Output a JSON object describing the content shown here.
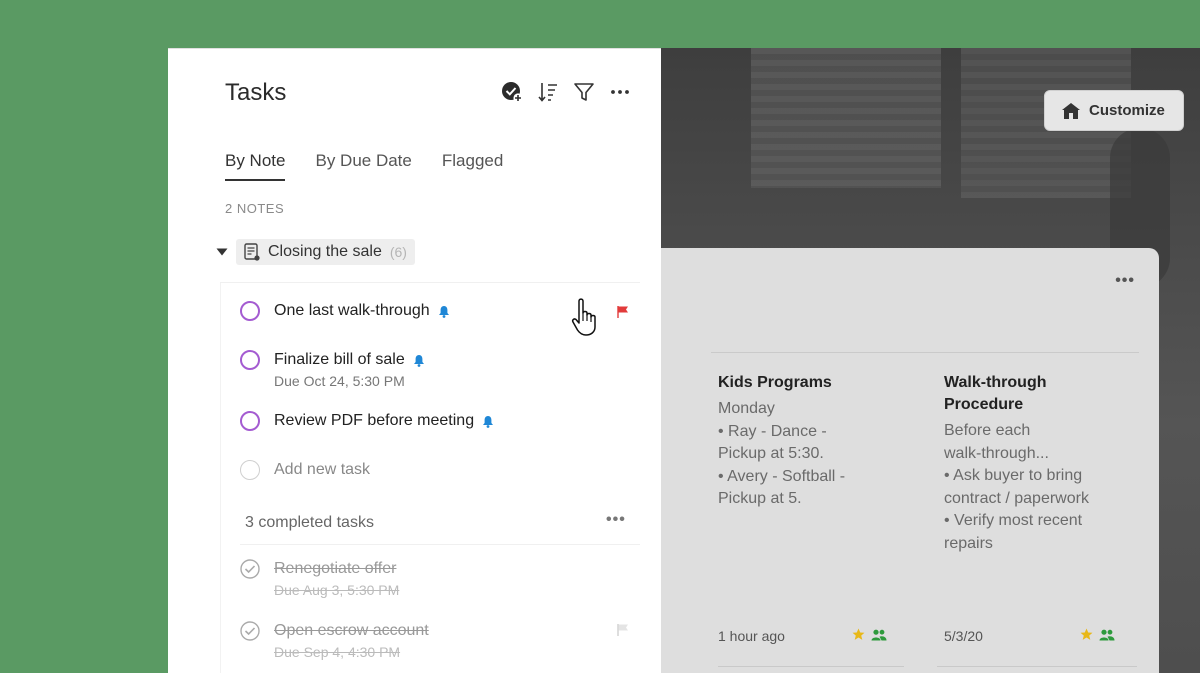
{
  "right": {
    "customize_label": "Customize",
    "notes": [
      {
        "title": "Kids Programs",
        "body": "Monday\n• Ray - Dance -\nPickup at 5:30.\n• Avery - Softball -\nPickup at 5.",
        "date": "1 hour ago"
      },
      {
        "title": "Walk-through\nProcedure",
        "body": "Before each\nwalk-through...\n• Ask buyer to bring\ncontract / paperwork\n• Verify most recent\nrepairs",
        "date": "5/3/20"
      }
    ]
  },
  "tasks": {
    "title": "Tasks",
    "tabs": [
      {
        "label": "By Note",
        "active": true
      },
      {
        "label": "By Due Date",
        "active": false
      },
      {
        "label": "Flagged",
        "active": false
      }
    ],
    "notes_count": "2 NOTES",
    "group": {
      "name": "Closing the sale",
      "count": "(6)"
    },
    "items": [
      {
        "title": "One last walk-through",
        "due": "",
        "reminder": true,
        "flagged": true
      },
      {
        "title": "Finalize bill of sale",
        "due": "Due Oct 24, 5:30 PM",
        "reminder": true,
        "flagged": false
      },
      {
        "title": "Review PDF before meeting",
        "due": "",
        "reminder": true,
        "flagged": false
      }
    ],
    "add_task_label": "Add new task",
    "completed_label": "3 completed tasks",
    "completed": [
      {
        "title": "Renegotiate offer",
        "due": "Due Aug 3, 5:30 PM",
        "flagged": false
      },
      {
        "title": "Open escrow account",
        "due": "Due Sep 4, 4:30 PM",
        "flagged": true
      }
    ]
  },
  "colors": {
    "background": "#5a9a63",
    "task_circle": "#a45bd1",
    "reminder_bell": "#1f87d6",
    "flag_red": "#e23b3b",
    "star": "#e8b818",
    "shared_green": "#2e9a3c"
  }
}
